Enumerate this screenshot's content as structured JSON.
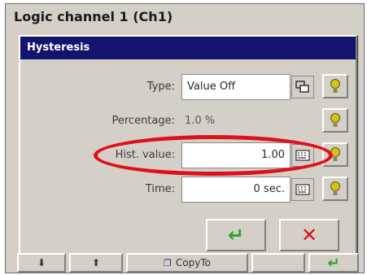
{
  "window": {
    "title": "Logic channel 1 (Ch1)"
  },
  "dialog": {
    "title": "Hysteresis",
    "fields": {
      "type": {
        "label": "Type:",
        "value": "Value Off"
      },
      "percentage": {
        "label": "Percentage:",
        "value": "1.0 %"
      },
      "hist_value": {
        "label": "Hist. value:",
        "value": "1.00"
      },
      "time": {
        "label": "Time:",
        "value": "0 sec."
      }
    },
    "ok_symbol": "↵",
    "cancel_symbol": "✕"
  },
  "bottom_bar": {
    "copy_to_label": "CopyTo",
    "down_symbol": "⬇",
    "up_symbol": "⬆",
    "enter_symbol": "↵"
  },
  "colors": {
    "dialog_title_bg": "#14146e",
    "highlight": "#e0101a",
    "hint_icon": "#d4c21a",
    "ok_green": "#2aa52a",
    "cancel_red": "#e0101a"
  }
}
